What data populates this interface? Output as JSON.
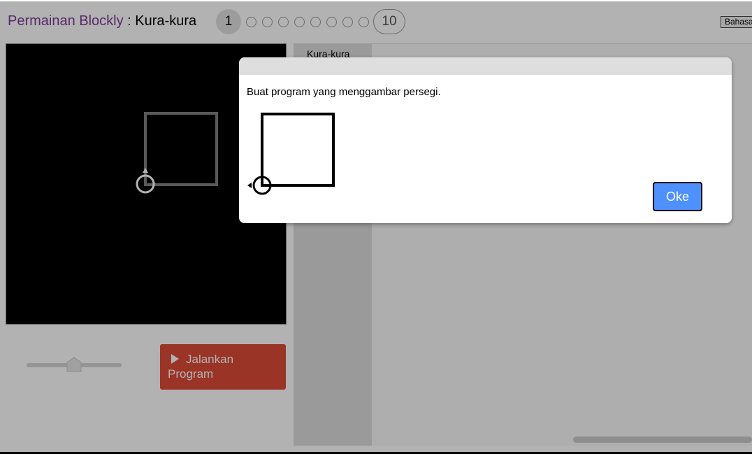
{
  "header": {
    "app_title": "Permainan Blockly",
    "separator": " : ",
    "game_name": "Kura-kura",
    "levels": {
      "current": "1",
      "last": "10",
      "intermediate_count": 8
    },
    "language_label": "Bahasa Indonesia"
  },
  "controls": {
    "speed_slider": {
      "value": 0.5
    },
    "run_button_label": "Jalankan Program"
  },
  "toolbox": {
    "category_label": "Kura-kura"
  },
  "dialog": {
    "instruction": "Buat program yang menggambar persegi.",
    "ok_label": "Oke"
  },
  "colors": {
    "title_link": "#7d3c98",
    "run_button": "#dd4b39",
    "ok_button": "#4d90fe"
  }
}
